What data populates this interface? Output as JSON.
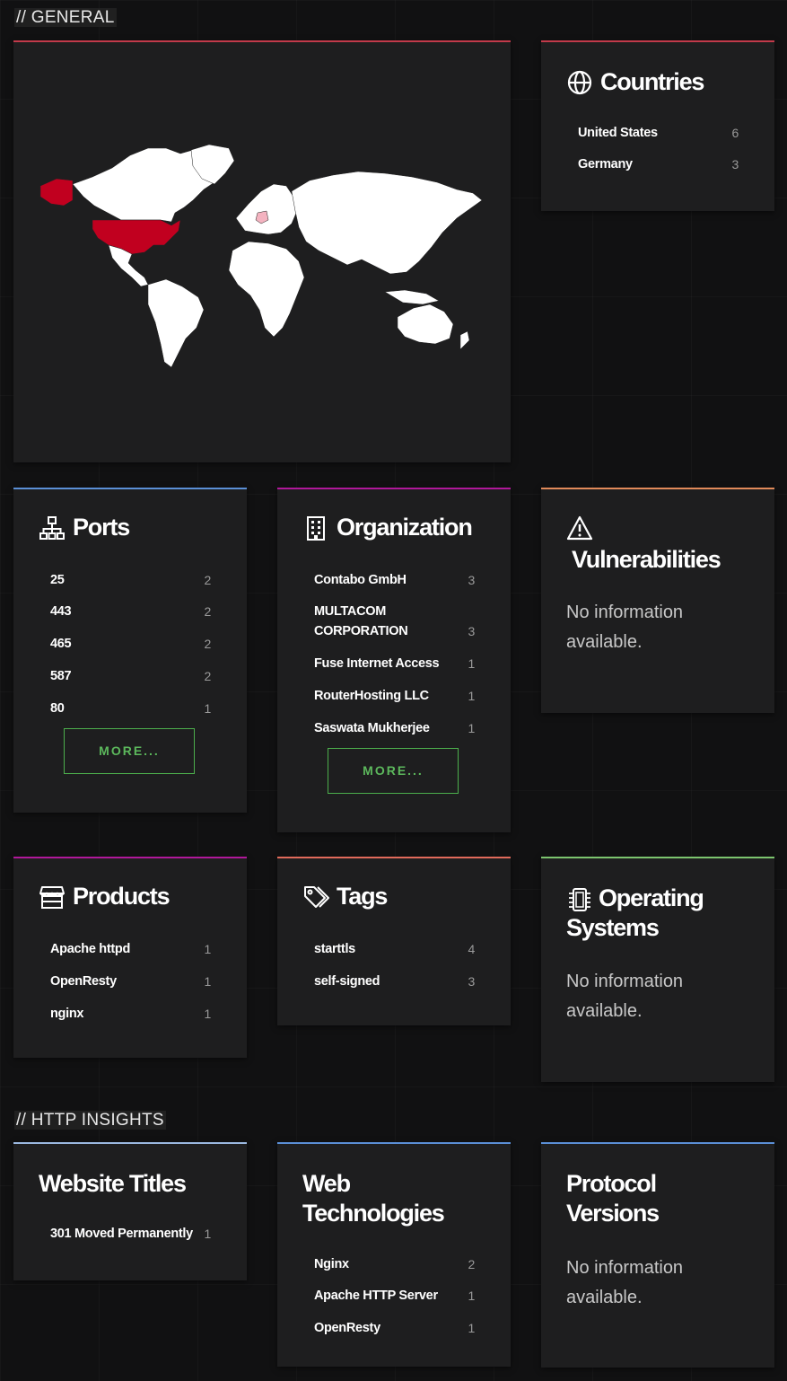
{
  "sections": {
    "general": "// GENERAL",
    "http": "// HTTP INSIGHTS"
  },
  "colors": {
    "card_bg": "#1e1e1f",
    "red_accent": "#c23a4a",
    "blue_accent": "#5b8fd6",
    "purple_accent": "#b0189a",
    "orange_accent": "#e08a5a",
    "green_accent": "#7cc46e",
    "map_highlight": "#c1001f",
    "button_green": "#5cb85c"
  },
  "countries": {
    "title": "Countries",
    "icon": "globe-icon",
    "items": [
      {
        "label": "United States",
        "count": "6"
      },
      {
        "label": "Germany",
        "count": "3"
      }
    ]
  },
  "ports": {
    "title": "Ports",
    "icon": "network-icon",
    "items": [
      {
        "label": "25",
        "count": "2"
      },
      {
        "label": "443",
        "count": "2"
      },
      {
        "label": "465",
        "count": "2"
      },
      {
        "label": "587",
        "count": "2"
      },
      {
        "label": "80",
        "count": "1"
      }
    ],
    "more": "MORE..."
  },
  "organization": {
    "title": "Organization",
    "icon": "building-icon",
    "items": [
      {
        "label": "Contabo GmbH",
        "count": "3"
      },
      {
        "label": "MULTACOM CORPORATION",
        "count": "3"
      },
      {
        "label": "Fuse Internet Access",
        "count": "1"
      },
      {
        "label": "RouterHosting LLC",
        "count": "1"
      },
      {
        "label": "Saswata Mukherjee",
        "count": "1"
      }
    ],
    "more": "MORE..."
  },
  "vulnerabilities": {
    "title": "Vulnerabilities",
    "icon": "warning-icon",
    "empty": "No information available."
  },
  "products": {
    "title": "Products",
    "icon": "store-icon",
    "items": [
      {
        "label": "Apache httpd",
        "count": "1"
      },
      {
        "label": "OpenResty",
        "count": "1"
      },
      {
        "label": "nginx",
        "count": "1"
      }
    ]
  },
  "tags": {
    "title": "Tags",
    "icon": "tags-icon",
    "items": [
      {
        "label": "starttls",
        "count": "4"
      },
      {
        "label": "self-signed",
        "count": "3"
      }
    ]
  },
  "os": {
    "title": "Operating Systems",
    "icon": "cpu-icon",
    "empty": "No information available."
  },
  "website_titles": {
    "title": "Website Titles",
    "items": [
      {
        "label": "301 Moved Permanently",
        "count": "1"
      }
    ]
  },
  "web_tech": {
    "title": "Web Technologies",
    "items": [
      {
        "label": "Nginx",
        "count": "2"
      },
      {
        "label": "Apache HTTP Server",
        "count": "1"
      },
      {
        "label": "OpenResty",
        "count": "1"
      }
    ]
  },
  "protocol": {
    "title": "Protocol Versions",
    "empty": "No information available."
  }
}
